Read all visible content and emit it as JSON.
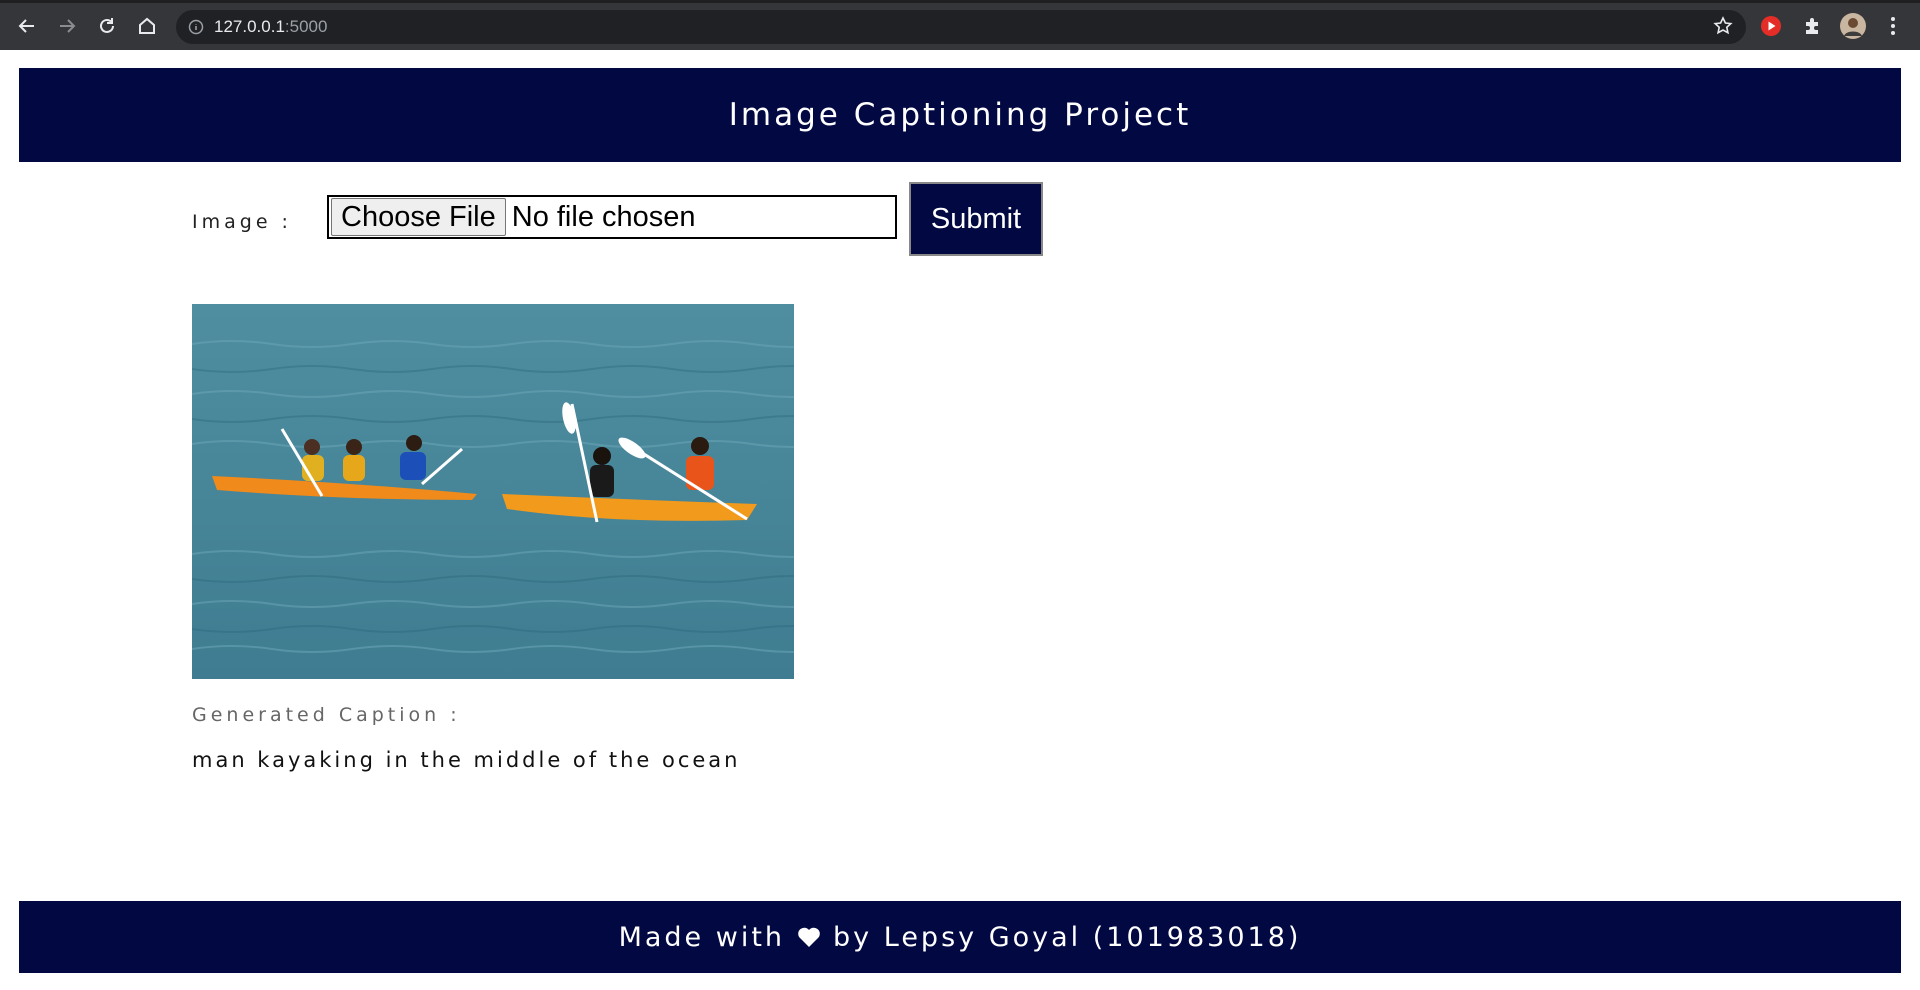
{
  "browser": {
    "url_host": "127.0.0.1",
    "url_port": ":5000",
    "icons": [
      "back-icon",
      "forward-icon",
      "reload-icon",
      "home-icon",
      "info-icon",
      "star-icon",
      "youtube-extension-icon",
      "extensions-icon",
      "profile-avatar",
      "menu-icon"
    ]
  },
  "header": {
    "title": "Image Captioning Project"
  },
  "form": {
    "image_label": "Image :",
    "choose_file_label": "Choose File",
    "no_file_text": "No file chosen",
    "submit_label": "Submit"
  },
  "result": {
    "image_description_alt": "kayakers",
    "caption_label": "Generated Caption :",
    "caption_text": "man kayaking in the middle of the ocean"
  },
  "footer": {
    "text_before": "Made with",
    "icon": "heart-icon",
    "text_after": "by Lepsy Goyal (101983018)"
  },
  "colors": {
    "brand_navy": "#020842",
    "chrome_bg": "#35363a",
    "omnibox_bg": "#202124"
  }
}
